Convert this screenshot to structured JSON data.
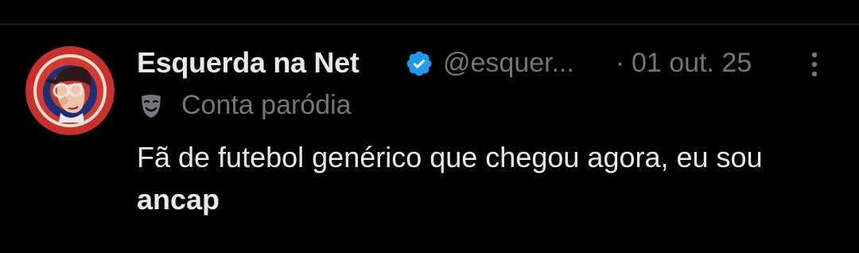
{
  "tweet": {
    "author": {
      "display_name": "Esquerda na Net",
      "handle": "@esquer...",
      "verified": true,
      "verified_color": "#1d9bf0",
      "avatar_icon": "cartoon-avatar"
    },
    "separator": "·",
    "date": "01 out. 25",
    "account_label": "Conta paródia",
    "account_label_icon": "theater-mask-icon",
    "more_icon": "more-vertical-icon",
    "text_parts": {
      "plain": "Fã de futebol genérico que chegou agora, eu sou ",
      "bold": "ancap"
    }
  },
  "colors": {
    "background": "#000000",
    "primary_text": "#e7e9ea",
    "secondary_text": "#71767b",
    "divider": "#2f3336"
  }
}
